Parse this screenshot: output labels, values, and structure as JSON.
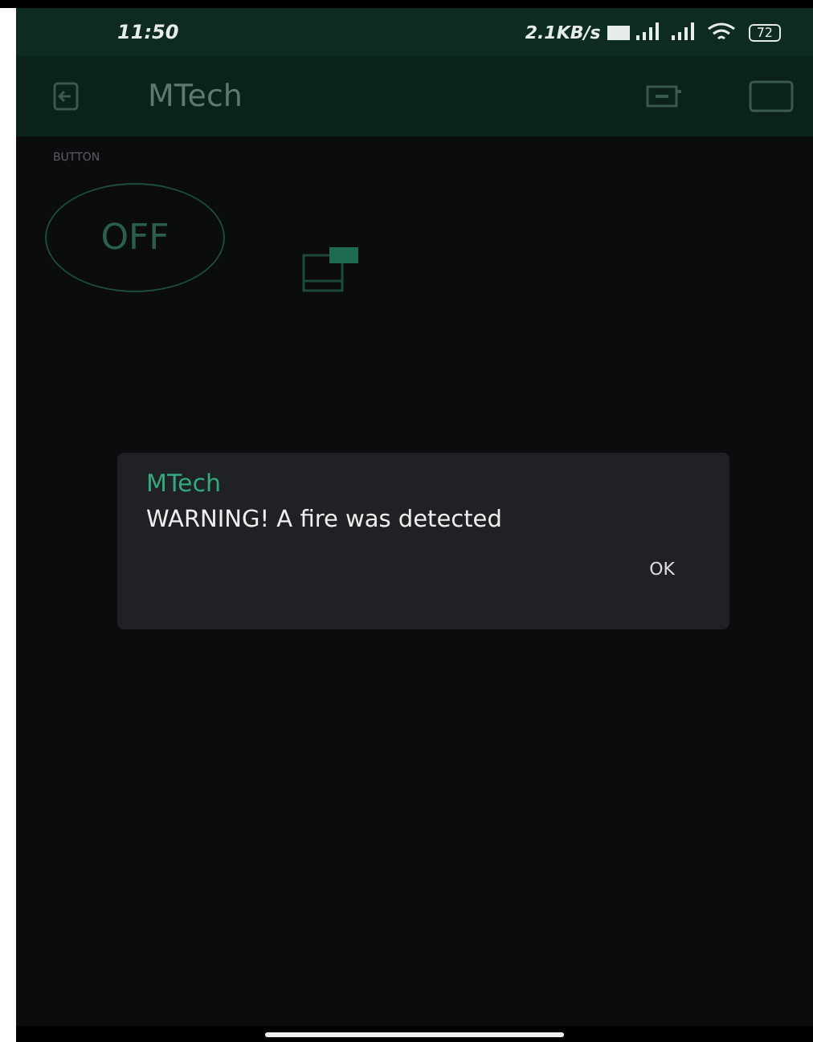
{
  "status_bar": {
    "time": "11:50",
    "speed": "2.1KB/s",
    "battery": "72"
  },
  "app_bar": {
    "title": "MTech"
  },
  "widgets": [
    {
      "kind": "button",
      "label": "BUTTON",
      "state_text": "OFF",
      "on": false
    }
  ],
  "dialog": {
    "title": "MTech",
    "message": "WARNING! A fire was detected",
    "buttons": [
      "OK"
    ]
  }
}
